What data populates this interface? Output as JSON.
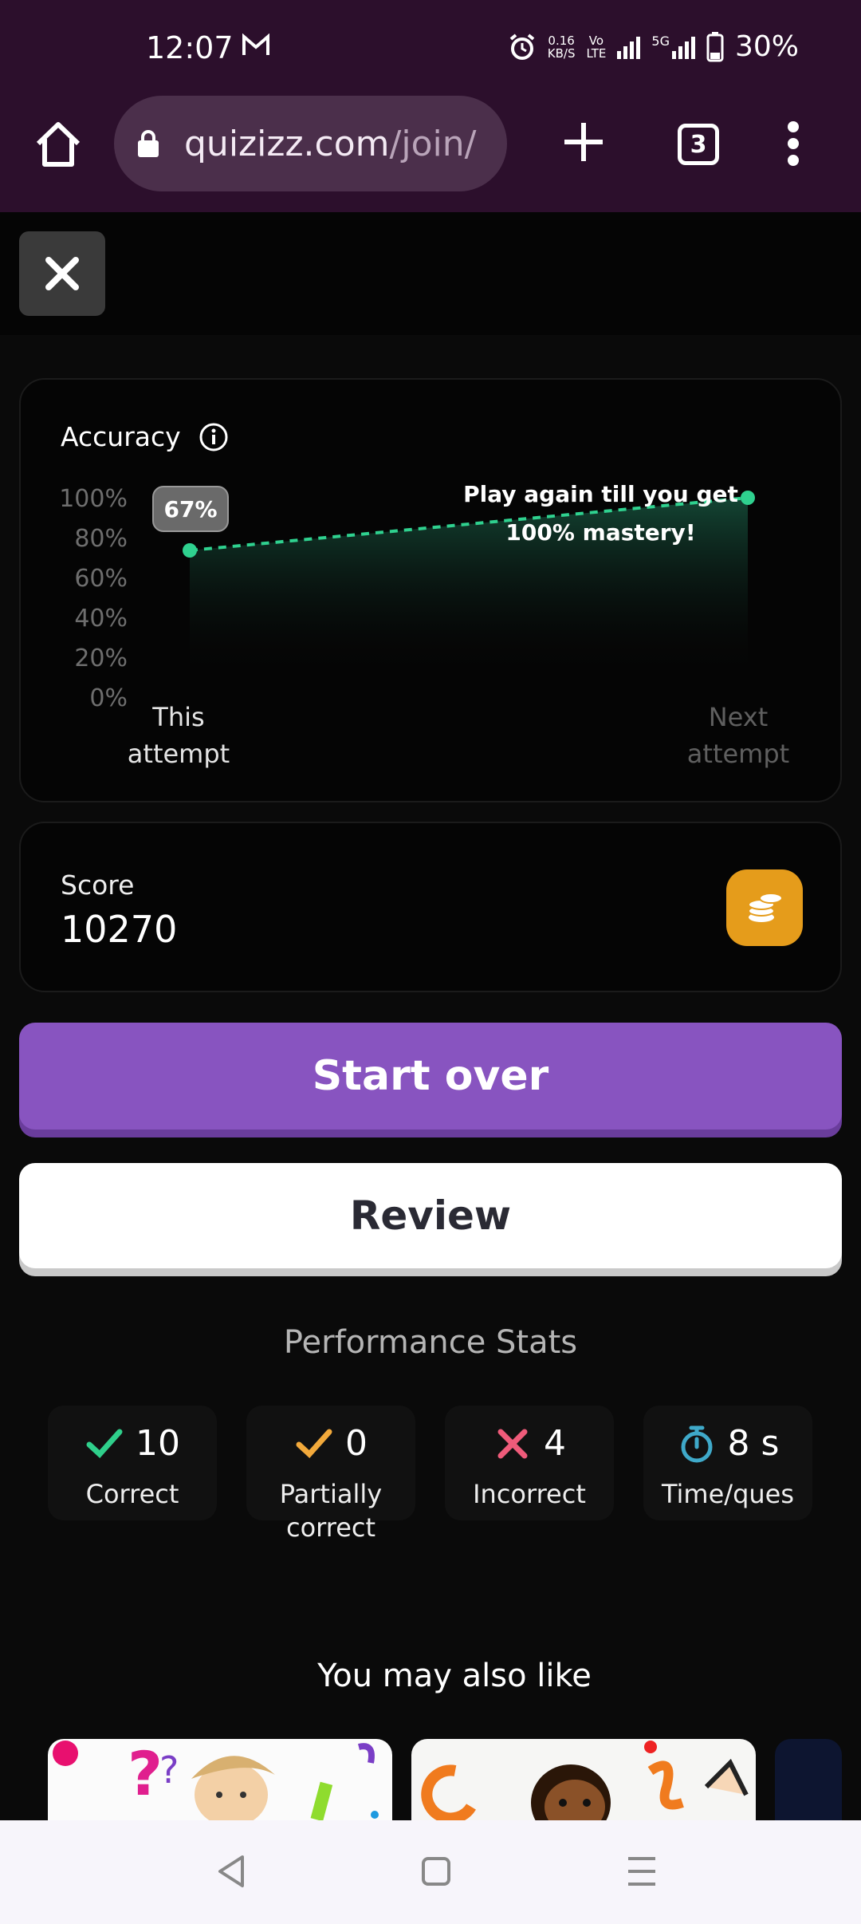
{
  "status_bar": {
    "time": "12:07",
    "net_speed_top": "0.16",
    "net_speed_bottom": "KB/S",
    "volte_top": "Vo",
    "volte_bottom": "LTE",
    "network": "5G",
    "battery": "30%"
  },
  "browser": {
    "url_domain": "quizizz.com",
    "url_path": "/join/",
    "tab_count": "3"
  },
  "accuracy": {
    "title": "Accuracy",
    "badge": "67%",
    "note_line1": "Play again till you get",
    "note_line2": "100% mastery!",
    "x_this": "This attempt",
    "x_next": "Next attempt"
  },
  "chart_data": {
    "type": "area",
    "categories": [
      "This attempt",
      "Next attempt"
    ],
    "values": [
      67,
      100
    ],
    "yticks": [
      "100%",
      "80%",
      "60%",
      "40%",
      "20%",
      "0%"
    ],
    "ylim": [
      0,
      100
    ],
    "color": "#2fd18f"
  },
  "score": {
    "label": "Score",
    "value": "10270"
  },
  "buttons": {
    "start_over": "Start over",
    "review": "Review"
  },
  "performance": {
    "title": "Performance Stats",
    "stats": [
      {
        "value": "10",
        "label": "Correct",
        "color": "#2fcf8b",
        "icon": "check-icon"
      },
      {
        "value": "0",
        "label": "Partially correct",
        "color": "#f2a93b",
        "icon": "check-icon"
      },
      {
        "value": "4",
        "label": "Incorrect",
        "color": "#ef5b7a",
        "icon": "cross-icon"
      },
      {
        "value": "8 s",
        "label": "Time/ques",
        "color": "#3fa9c9",
        "icon": "stopwatch-icon"
      }
    ]
  },
  "recommendations": {
    "title": "You may also like"
  }
}
